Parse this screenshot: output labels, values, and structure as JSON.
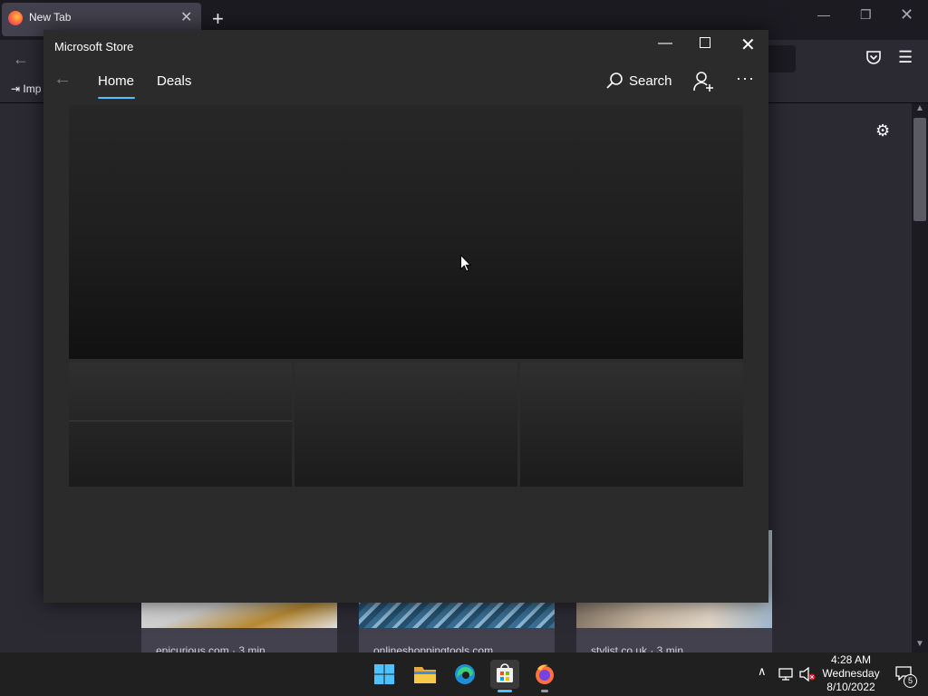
{
  "firefox": {
    "tab_title": "New Tab",
    "tab_close": "✕",
    "new_tab_glyph": "+",
    "import_label": "Imp",
    "stories": [
      {
        "source": "epicurious.com · 3 min"
      },
      {
        "source": "onlineshoppingtools.com"
      },
      {
        "source": "stylist.co.uk · 3 min"
      }
    ],
    "icons": [
      "firefox-logo-icon",
      "back-arrow-icon",
      "pocket-icon",
      "hamburger-menu-icon",
      "import-icon",
      "gear-icon",
      "minimize-icon",
      "restore-icon",
      "close-icon"
    ]
  },
  "store": {
    "title": "Microsoft Store",
    "nav": {
      "home": "Home",
      "deals": "Deals",
      "search": "Search",
      "more": "···"
    },
    "accent": "#4cc2ff",
    "icons": [
      "back-arrow-icon",
      "search-icon",
      "account-add-icon",
      "more-icon",
      "minimize-icon",
      "maximize-icon",
      "close-icon"
    ]
  },
  "taskbar": {
    "apps": [
      "start",
      "file-explorer",
      "edge",
      "microsoft-store",
      "firefox"
    ],
    "active_app": "microsoft-store",
    "clock": {
      "time": "4:28 AM",
      "day": "Wednesday",
      "date": "8/10/2022"
    },
    "notification_count": "5"
  }
}
